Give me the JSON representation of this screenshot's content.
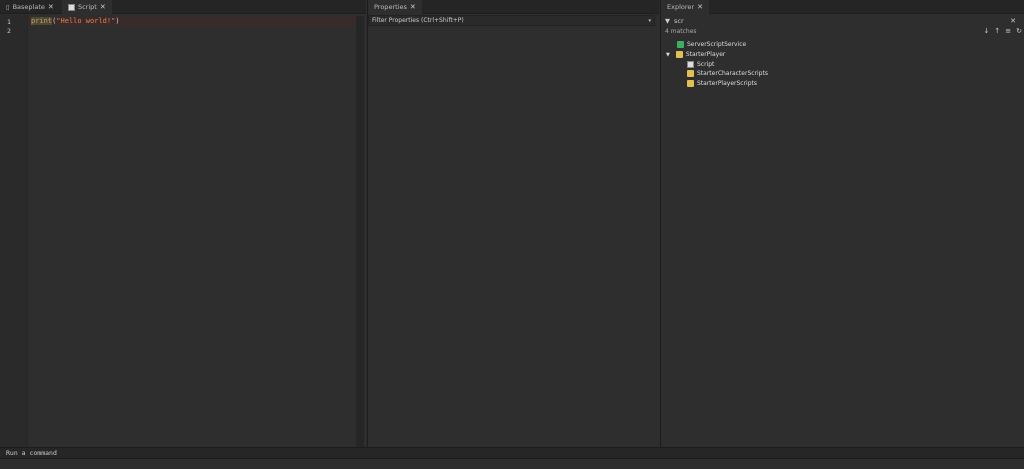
{
  "editor": {
    "tabs": [
      {
        "label": "Baseplate"
      },
      {
        "label": "Script"
      }
    ],
    "lines": [
      "1",
      "2"
    ],
    "code": {
      "keyword": "print",
      "open": "(",
      "string": "\"Hello world!\"",
      "close": ")"
    }
  },
  "properties": {
    "tab": "Properties",
    "filter_placeholder": "Filter Properties (Ctrl+Shift+P)"
  },
  "explorer": {
    "tab": "Explorer",
    "search_value": "scr",
    "matches": "4 matches",
    "tree": [
      {
        "label": "ServerScriptService"
      },
      {
        "label": "StarterPlayer"
      },
      {
        "label": "Script"
      },
      {
        "label": "StarterCharacterScripts"
      },
      {
        "label": "StarterPlayerScripts"
      }
    ]
  },
  "command_bar": {
    "placeholder": "Run a command"
  },
  "close_glyph": "✕"
}
